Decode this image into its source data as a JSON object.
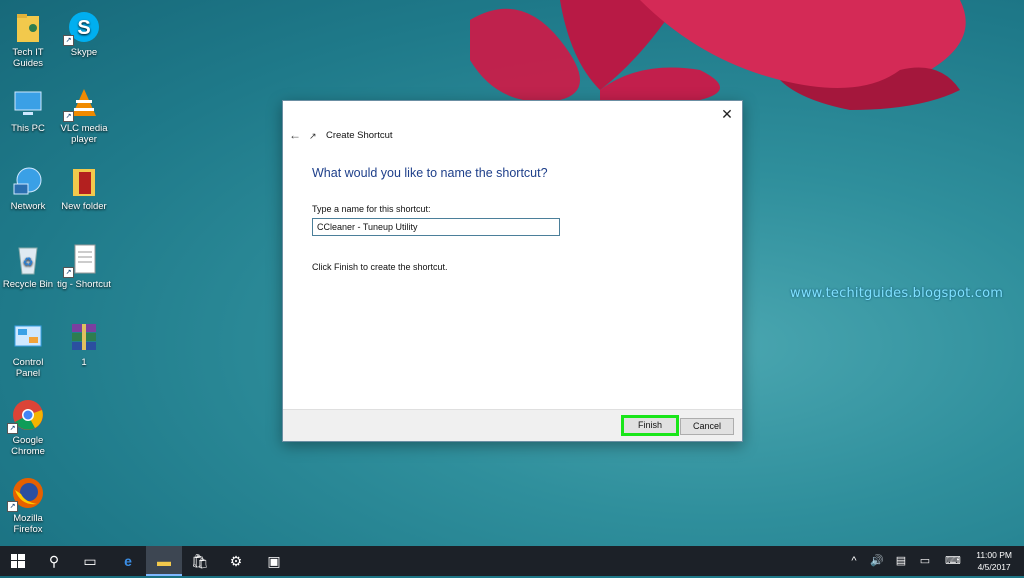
{
  "desktop": {
    "icons": [
      {
        "label": "Tech IT Guides",
        "icon": "folder-user-icon"
      },
      {
        "label": "Skype",
        "icon": "skype-icon"
      },
      {
        "label": "This PC",
        "icon": "computer-icon"
      },
      {
        "label": "VLC media player",
        "icon": "vlc-icon"
      },
      {
        "label": "Network",
        "icon": "network-icon"
      },
      {
        "label": "New folder",
        "icon": "folder-icon"
      },
      {
        "label": "Recycle Bin",
        "icon": "recycle-bin-icon"
      },
      {
        "label": "tig - Shortcut",
        "icon": "document-icon"
      },
      {
        "label": "Control Panel",
        "icon": "control-panel-icon"
      },
      {
        "label": "1",
        "icon": "winrar-icon"
      },
      {
        "label": "Google Chrome",
        "icon": "chrome-icon"
      },
      {
        "label": "Mozilla Firefox",
        "icon": "firefox-icon"
      }
    ],
    "watermark": "www.techitguides.blogspot.com"
  },
  "dialog": {
    "title": "Create Shortcut",
    "heading": "What would you like to name the shortcut?",
    "field_label": "Type a name for this shortcut:",
    "name_value": "CCleaner - Tuneup Utility",
    "hint": "Click Finish to create the shortcut.",
    "finish_label": "Finish",
    "cancel_label": "Cancel",
    "close_glyph": "✕",
    "back_glyph": "←"
  },
  "taskbar": {
    "time": "11:00 PM",
    "date": "4/5/2017"
  },
  "colors": {
    "highlight": "#19e619",
    "heading": "#1e3f8a"
  }
}
